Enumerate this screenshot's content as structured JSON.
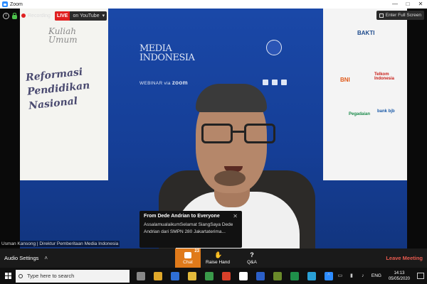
{
  "window": {
    "title": "Zoom",
    "controls": [
      "—",
      "□",
      "✕"
    ]
  },
  "topbar": {
    "recording": "Recording",
    "live_badge": "LIVE",
    "live_target": "on YouTube",
    "live_caret": "▾",
    "fullscreen": "Enter Full Screen"
  },
  "video": {
    "banner_left_top": "Kuliah Umum",
    "banner_left_main": "Reformasi Pendidikan Nasional",
    "media_logo": "MEDIA INDONESIA",
    "webinar": "WEBINAR via",
    "webinar_zoom": "zoom",
    "sponsors": [
      "BAKTI",
      "BNI",
      "Telkom Indonesia",
      "Pegadaian",
      "bank bjb"
    ],
    "participant_name": "Usman Kansong | Direktur Pemberitaan Media Indonesia"
  },
  "chat_popup": {
    "from": "From Dede Andrian to Everyone",
    "message": "AssalamualaikumSelamat SiangSaya Dede Andrian dari SMPN 280 Jakartaterima...",
    "close": "✕"
  },
  "toolbar": {
    "audio_settings": "Audio Settings",
    "caret": "˄",
    "chat": "Chat",
    "chat_count": "23",
    "raise_hand": "Raise Hand",
    "qa": "Q&A",
    "leave": "Leave Meeting"
  },
  "taskbar": {
    "search_placeholder": "Type here to search",
    "lang": "ENG",
    "time": "14:13",
    "date": "05/05/2020",
    "app_colors": [
      "#888888",
      "#e0a82a",
      "#2f6fd6",
      "#e2b93b",
      "#3a9a4a",
      "#d8402a",
      "#ffffff",
      "#2b5fc8",
      "#6a8a2a",
      "#1f8f4a",
      "#2aa0d6",
      "#2d8cff"
    ]
  },
  "colors": {
    "accent": "#e07a1a",
    "live": "#e02020",
    "leave": "#e85a4f",
    "zoom": "#2d8cff"
  }
}
